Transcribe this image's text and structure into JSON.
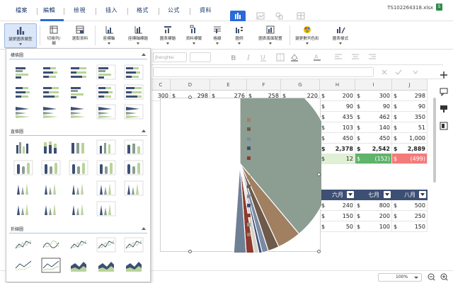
{
  "menu": {
    "tabs": [
      "檔案",
      "編輯",
      "檢視",
      "插入",
      "格式",
      "公式",
      "資料"
    ],
    "filename": "TS102264318.xlsx",
    "save_badge": "S"
  },
  "ribbon": {
    "buttons": [
      {
        "line1": "變更圖表類型",
        "line2": "",
        "icon": "bar-chart"
      },
      {
        "line1": "切換列/",
        "line2": "欄",
        "icon": "switch-row-column"
      },
      {
        "line1": "選取資料",
        "line2": "",
        "icon": "select-data"
      },
      {
        "line1": "座標軸",
        "line2": "",
        "icon": "axis"
      },
      {
        "line1": "座標軸標題",
        "line2": "",
        "icon": "axis-title"
      },
      {
        "line1": "圖表標題",
        "line2": "",
        "icon": "chart-title"
      },
      {
        "line1": "資料標籤",
        "line2": "",
        "icon": "data-labels"
      },
      {
        "line1": "格線",
        "line2": "",
        "icon": "gridlines"
      },
      {
        "line1": "圖例",
        "line2": "",
        "icon": "legend"
      },
      {
        "line1": "圖表版面配置",
        "line2": "",
        "icon": "layout"
      },
      {
        "line1": "變更數列色彩",
        "line2": "",
        "icon": "color-palette"
      },
      {
        "line1": "圖表樣式",
        "line2": "",
        "icon": "chart-style"
      }
    ]
  },
  "format_bar": {
    "font_name": "JhengHei"
  },
  "columns": [
    "C",
    "D",
    "E",
    "F",
    "G",
    "H",
    "I",
    "J"
  ],
  "grid": {
    "row0": [
      "300",
      "$",
      "298",
      "$",
      "276",
      "$",
      "258",
      "$",
      "220",
      "$"
    ],
    "h": [
      "200",
      "90",
      "435",
      "103",
      "450",
      "2,378",
      "12"
    ],
    "i": [
      "300",
      "90",
      "462",
      "140",
      "450",
      "2,542",
      "(152)"
    ],
    "j": [
      "298",
      "90",
      "350",
      "51",
      "1,000",
      "2,889",
      "(499)"
    ],
    "bottom_h": [
      "240",
      "150",
      "50"
    ],
    "bottom_i": [
      "800",
      "200",
      "100"
    ],
    "bottom_j": [
      "500",
      "250",
      "150"
    ],
    "month_headers": [
      "六月",
      "七月",
      "八月"
    ]
  },
  "chart_panel": {
    "sections": [
      {
        "title": "橫條圖"
      },
      {
        "title": "直條圖"
      },
      {
        "title": "折線圖"
      }
    ]
  },
  "chart_data": {
    "type": "pie",
    "slices_deg": [
      {
        "color": "#8c9d92",
        "start": 0,
        "end": 140
      },
      {
        "color": "#a08060",
        "start": 140,
        "end": 155
      },
      {
        "color": "#6e5a4a",
        "start": 155,
        "end": 162
      },
      {
        "color": "#7b8aa3",
        "start": 162,
        "end": 166
      },
      {
        "color": "#3d4f73",
        "start": 166,
        "end": 168
      },
      {
        "color": "#d6d1c9",
        "start": 168,
        "end": 171
      },
      {
        "color": "#8d3b2f",
        "start": 171,
        "end": 176
      },
      {
        "color": "#6f7f94",
        "start": 176,
        "end": 184
      }
    ],
    "legend_colors": [
      "#8c9d92",
      "#a08060",
      "#6e5a4a",
      "#7b8aa3",
      "#3d4f73",
      "#8d3b2f",
      "#8c9d92",
      "#a08060",
      "#6e5a4a",
      "#7b8aa3",
      "#3d4f73",
      "#8d3b2f",
      "#8c9d92",
      "#a08060"
    ]
  },
  "status": {
    "zoom": "100%"
  },
  "colors": {
    "accent": "#2a6ad8",
    "header_dark": "#3d4f73",
    "positive": "#dff0d4",
    "negative": "#f47b7b",
    "ok": "#5fb36b"
  }
}
